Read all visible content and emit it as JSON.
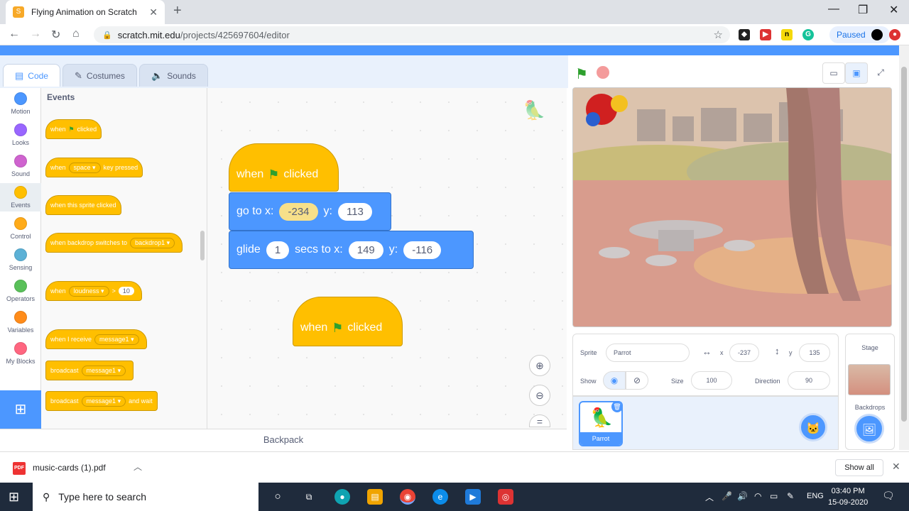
{
  "browser": {
    "tab_title": "Flying Animation on Scratch",
    "url_host": "scratch.mit.edu",
    "url_path": "/projects/425697604/editor",
    "paused_label": "Paused"
  },
  "editor": {
    "tabs": [
      {
        "label": "Code"
      },
      {
        "label": "Costumes"
      },
      {
        "label": "Sounds"
      }
    ],
    "categories": [
      {
        "label": "Motion",
        "color": "#4c97ff"
      },
      {
        "label": "Looks",
        "color": "#9966ff"
      },
      {
        "label": "Sound",
        "color": "#cf63cf"
      },
      {
        "label": "Events",
        "color": "#ffbf00"
      },
      {
        "label": "Control",
        "color": "#ffab19"
      },
      {
        "label": "Sensing",
        "color": "#5cb1d6"
      },
      {
        "label": "Operators",
        "color": "#59c059"
      },
      {
        "label": "Variables",
        "color": "#ff8c1a"
      },
      {
        "label": "My Blocks",
        "color": "#ff6680"
      }
    ],
    "palette": {
      "heading": "Events",
      "when_flag": {
        "pre": "when",
        "post": "clicked"
      },
      "when_key": {
        "pre": "when",
        "key": "space",
        "post": "key pressed"
      },
      "when_sprite": "when this sprite clicked",
      "when_backdrop": {
        "pre": "when backdrop switches to",
        "val": "backdrop1"
      },
      "when_loud": {
        "pre": "when",
        "val": "loudness",
        "gt": ">",
        "num": "10"
      },
      "when_receive": {
        "pre": "when I receive",
        "val": "message1"
      },
      "broadcast": {
        "pre": "broadcast",
        "val": "message1"
      },
      "broadcast_wait": {
        "pre": "broadcast",
        "val": "message1",
        "post": "and wait"
      }
    },
    "script": {
      "hat_pre": "when",
      "hat_post": "clicked",
      "goto_label": "go to x:",
      "goto_x": "-234",
      "goto_y_label": "y:",
      "goto_y": "113",
      "glide_label": "glide",
      "glide_secs": "1",
      "glide_mid": "secs to x:",
      "glide_x": "149",
      "glide_y_label": "y:",
      "glide_y": "-116",
      "hat2_pre": "when",
      "hat2_post": "clicked"
    },
    "backpack": "Backpack"
  },
  "sprite_info": {
    "sprite_label": "Sprite",
    "sprite_name": "Parrot",
    "x_label": "x",
    "x_value": "-237",
    "y_label": "y",
    "y_value": "135",
    "show_label": "Show",
    "size_label": "Size",
    "size_value": "100",
    "direction_label": "Direction",
    "direction_value": "90",
    "sprite_card": "Parrot",
    "stage_label": "Stage",
    "backdrops_label": "Backdrops"
  },
  "downloads": {
    "file": "music-cards (1).pdf",
    "icon_text": "PDF",
    "show_all": "Show all"
  },
  "taskbar": {
    "search_placeholder": "Type here to search",
    "lang": "ENG",
    "time": "03:40 PM",
    "date": "15-09-2020"
  }
}
